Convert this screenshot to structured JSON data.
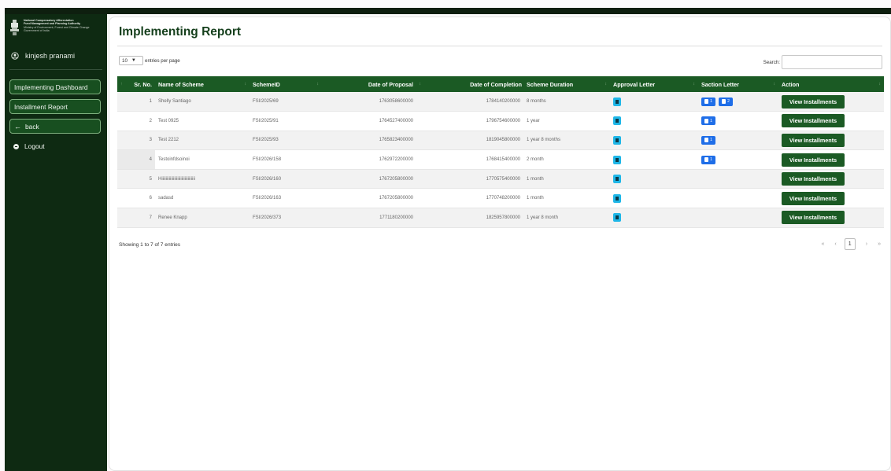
{
  "sidebar": {
    "brand": {
      "line1": "National Compensatory Afforestation",
      "line2": "Fund Management and Planning Authority",
      "line3": "Ministry of Environment, Forest and Climate Change",
      "line4": "Government of India"
    },
    "user_name": "kinjesh pranami",
    "nav": {
      "dashboard": "Implementing Dashboard",
      "installment_report": "Installment Report",
      "back": "back",
      "logout": "Logout"
    }
  },
  "main": {
    "title": "Implementing Report",
    "length_value": "10",
    "length_label": "entries per page",
    "search_label": "Search:",
    "columns": [
      "Sr. No.",
      "Name of Scheme",
      "SchemeID",
      "Date of Proposal",
      "Date of Completion",
      "Scheme Duration",
      "Approval Letter",
      "Saction Letter",
      "Action"
    ],
    "rows": [
      {
        "sr": "1",
        "name": "Shelly Santiago",
        "id": "FSI/2025/69",
        "proposal": "1763058600000",
        "completion": "1784140200000",
        "duration": "8 months"
      },
      {
        "sr": "2",
        "name": "Test 0925",
        "id": "FSI/2025/91",
        "proposal": "1764527400000",
        "completion": "1796754600000",
        "duration": "1 year"
      },
      {
        "sr": "3",
        "name": "Test 2212",
        "id": "FSI/2025/93",
        "proposal": "1765823400000",
        "completion": "1819045800000",
        "duration": "1 year 8 months"
      },
      {
        "sr": "4",
        "name": "Testoinfdsoinoi",
        "id": "FSI/2026/158",
        "proposal": "1762972200000",
        "completion": "1768415400000",
        "duration": "2 month"
      },
      {
        "sr": "5",
        "name": "Hiiiiiiiiiiiiiiiiiiiiiiiiiiiiiiii",
        "id": "FSI/2026/160",
        "proposal": "1767205800000",
        "completion": "1770575400000",
        "duration": "1 month"
      },
      {
        "sr": "6",
        "name": "sadasd",
        "id": "FSI/2026/163",
        "proposal": "1767205800000",
        "completion": "1770748200000",
        "duration": "1 month"
      },
      {
        "sr": "7",
        "name": "Renee Knapp",
        "id": "FSI/2026/373",
        "proposal": "1771180200000",
        "completion": "1825957800000",
        "duration": "1 year 8 month"
      }
    ],
    "saction_letters": [
      [
        "1",
        "2"
      ],
      [
        "1"
      ],
      [
        "1"
      ],
      [
        "1"
      ],
      [],
      [],
      []
    ],
    "action_label": "View Installments",
    "info": "Showing 1 to 7 of 7 entries",
    "pager": {
      "first": "«",
      "prev": "‹",
      "current": "1",
      "next": "›",
      "last": "»"
    }
  },
  "colors": {
    "sidebar_bg": "#0e2a12",
    "brand_green": "#1b5a24",
    "doc_icon": "#1fb7e8",
    "saction_icon": "#1f6ee8"
  }
}
